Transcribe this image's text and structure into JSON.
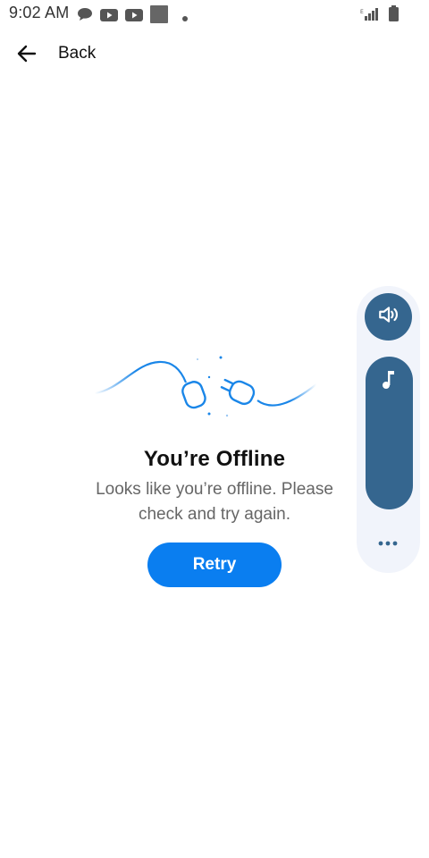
{
  "status_bar": {
    "time": "9:02 AM",
    "icons_left": [
      "chat-bubble-icon",
      "youtube-icon",
      "youtube-icon",
      "gallery-icon",
      "dot-icon"
    ],
    "icons_right": [
      "signal-icon",
      "battery-icon"
    ]
  },
  "header": {
    "back_label": "Back",
    "back_icon": "arrow-left-icon"
  },
  "offline": {
    "title": "You’re Offline",
    "message": "Looks like you’re offline. Please check and try again.",
    "retry_label": "Retry",
    "illustration_icon": "unplugged-cable-icon"
  },
  "volume_panel": {
    "mute_icon": "speaker-icon",
    "media_icon": "music-note-icon",
    "more_icon": "more-horizontal-icon",
    "media_level": 1.0
  },
  "colors": {
    "accent": "#0a7ef0",
    "panel_bg": "#f1f4fb",
    "panel_control": "#35668f",
    "illustration_stroke": "#1a86e8",
    "message_text": "#666666"
  }
}
